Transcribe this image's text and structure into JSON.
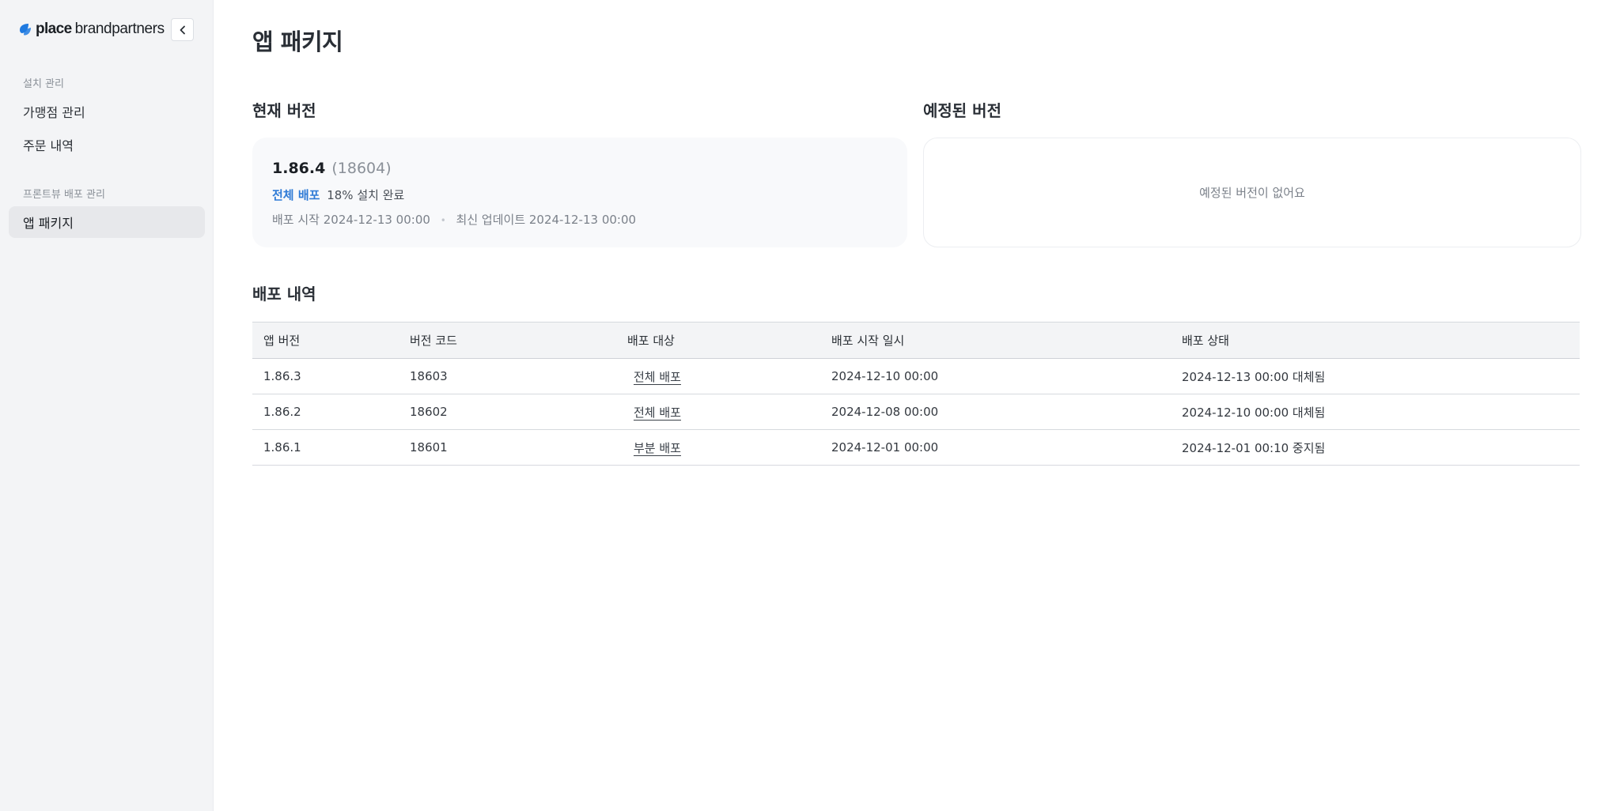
{
  "brand": {
    "name_bold": "place",
    "name_rest": "brandpartners",
    "accent_color": "#1f7ae0"
  },
  "sidebar": {
    "collapse_icon": "chevron-left-icon",
    "groups": [
      {
        "title": "설치 관리",
        "items": [
          {
            "label": "가맹점 관리",
            "active": false
          },
          {
            "label": "주문 내역",
            "active": false
          }
        ]
      },
      {
        "title": "프론트뷰 배포 관리",
        "items": [
          {
            "label": "앱 패키지",
            "active": true
          }
        ]
      }
    ]
  },
  "main": {
    "title": "앱 패키지",
    "current": {
      "section_title": "현재 버전",
      "version": "1.86.4",
      "code": "(18604)",
      "deploy_tag": "전체 배포",
      "deploy_status": "18% 설치 완료",
      "start": "배포 시작 2024-12-13 00:00",
      "updated": "최신 업데이트 2024-12-13 00:00"
    },
    "scheduled": {
      "section_title": "예정된 버전",
      "empty": "예정된 버전이 없어요"
    },
    "history": {
      "section_title": "배포 내역",
      "columns": [
        "앱 버전",
        "버전 코드",
        "배포 대상",
        "배포 시작 일시",
        "배포 상태"
      ],
      "rows": [
        {
          "version": "1.86.3",
          "code": "18603",
          "target": "전체 배포",
          "start": "2024-12-10 00:00",
          "status": "2024-12-13 00:00 대체됨"
        },
        {
          "version": "1.86.2",
          "code": "18602",
          "target": "전체 배포",
          "start": "2024-12-08 00:00",
          "status": "2024-12-10 00:00 대체됨"
        },
        {
          "version": "1.86.1",
          "code": "18601",
          "target": "부분 배포",
          "start": "2024-12-01 00:00",
          "status": "2024-12-01 00:10 중지됨"
        }
      ]
    }
  }
}
